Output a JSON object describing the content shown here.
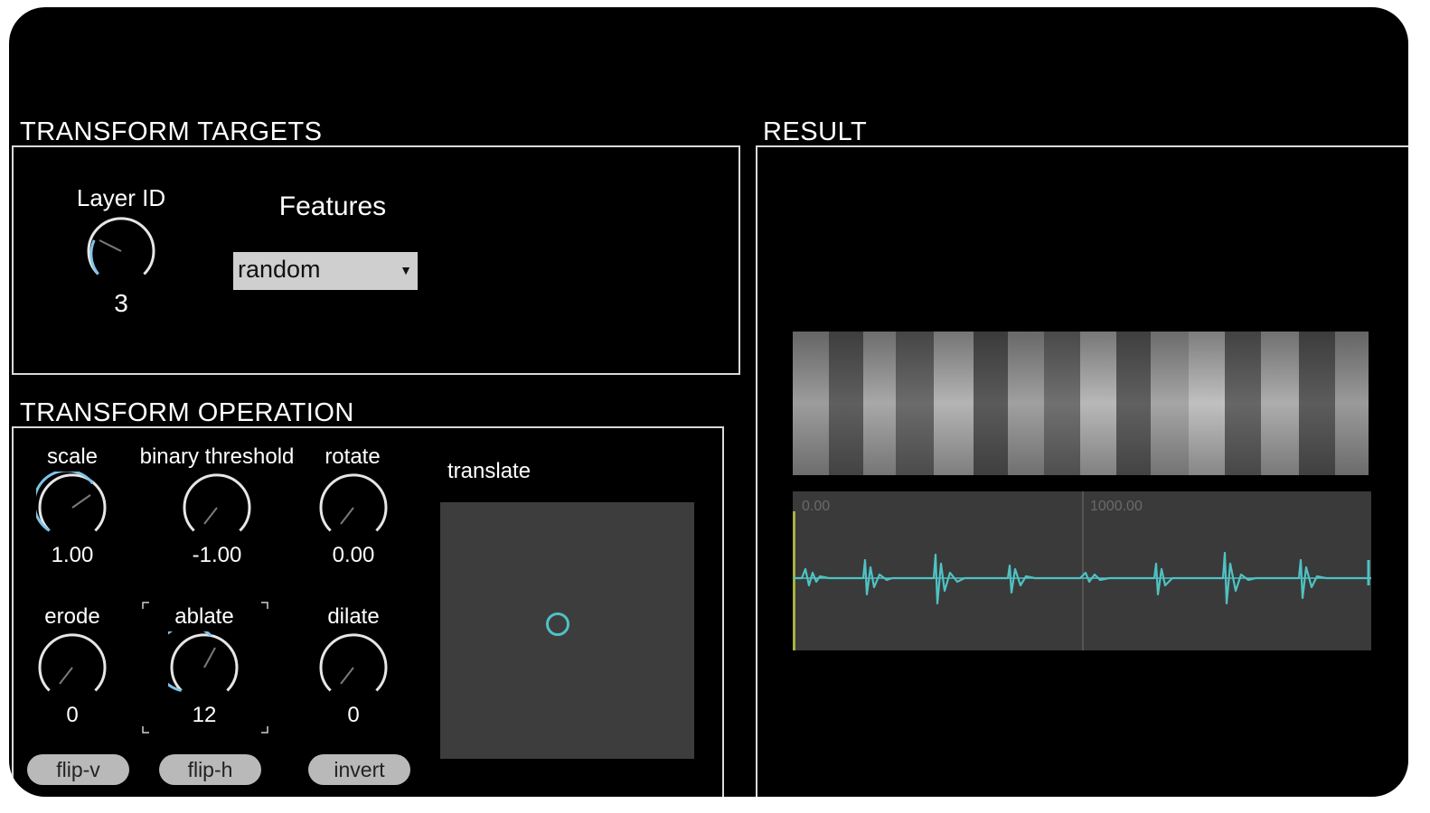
{
  "colors": {
    "background": "#000000",
    "accent": "#4fc2c4",
    "knob_track": "#e6e6e6",
    "knob_active": "#7fc4e8",
    "panel_border": "#d9d9d9",
    "pad": "#3d3d3d",
    "button": "#b9b9b9"
  },
  "targets": {
    "title": "TRANSFORM TARGETS",
    "layer_id": {
      "label": "Layer ID",
      "value": "3",
      "level": 0.15
    },
    "features": {
      "label": "Features",
      "selected": "random"
    }
  },
  "operation": {
    "title": "TRANSFORM OPERATION",
    "knobs": [
      {
        "key": "scale",
        "label": "scale",
        "value": "1.00",
        "level": 0.7
      },
      {
        "key": "binary-threshold",
        "label": "binary threshold",
        "value": "-1.00",
        "level": 0.0
      },
      {
        "key": "rotate",
        "label": "rotate",
        "value": "0.00",
        "level": 0.0
      },
      {
        "key": "erode",
        "label": "erode",
        "value": "0",
        "level": 0.0
      },
      {
        "key": "ablate",
        "label": "ablate",
        "value": "12",
        "level": 0.6
      },
      {
        "key": "dilate",
        "label": "dilate",
        "value": "0",
        "level": 0.0
      }
    ],
    "translate_label": "translate",
    "buttons": {
      "flip_v": "flip-v",
      "flip_h": "flip-h",
      "invert": "invert"
    }
  },
  "result": {
    "title": "RESULT",
    "waveform": {
      "tick_start": "0.00",
      "tick_mid": "1000.00"
    }
  }
}
